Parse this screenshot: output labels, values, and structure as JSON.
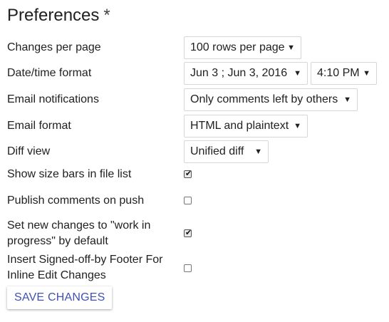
{
  "page": {
    "title": "Preferences",
    "dirty_marker": "*"
  },
  "preferences": {
    "changes_per_page": {
      "label": "Changes per page",
      "value": "100 rows per page"
    },
    "date_time_format": {
      "label": "Date/time format",
      "date_value": "Jun 3 ; Jun 3, 2016",
      "time_value": "4:10 PM"
    },
    "email_notifications": {
      "label": "Email notifications",
      "value": "Only comments left by others"
    },
    "email_format": {
      "label": "Email format",
      "value": "HTML and plaintext"
    },
    "diff_view": {
      "label": "Diff view",
      "value": "Unified diff"
    },
    "show_size_bars": {
      "label": "Show size bars in file list",
      "checked": true
    },
    "publish_comments_on_push": {
      "label": "Publish comments on push",
      "checked": false
    },
    "work_in_progress_default": {
      "label": "Set new changes to \"work in progress\" by default",
      "checked": true
    },
    "signed_off_by_footer": {
      "label": "Insert Signed-off-by Footer For Inline Edit Changes",
      "checked": false
    }
  },
  "actions": {
    "save_label": "SAVE CHANGES"
  },
  "icons": {
    "dropdown": "chevron-down-icon",
    "check": "checkmark-icon"
  },
  "colors": {
    "accent": "#3f51b5",
    "text": "#212121",
    "border": "#d6d6d6"
  }
}
